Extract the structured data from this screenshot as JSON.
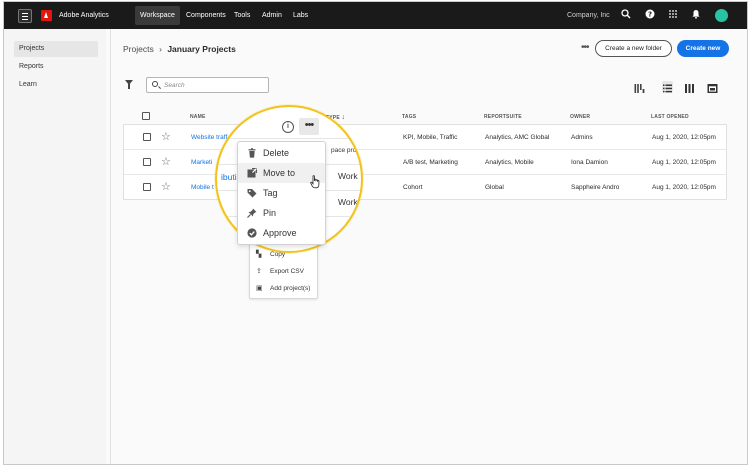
{
  "topbar": {
    "app_name": "Adobe Analytics",
    "nav": [
      "Workspace",
      "Components",
      "Tools",
      "Admin",
      "Labs"
    ],
    "company": "Company, Inc",
    "accent": "#e0170f"
  },
  "sidebar": {
    "items": [
      {
        "label": "Projects"
      },
      {
        "label": "Reports"
      },
      {
        "label": "Learn"
      }
    ]
  },
  "header": {
    "breadcrumb_root": "Projects",
    "breadcrumb_sep": "›",
    "breadcrumb_current": "January Projects",
    "more_label": "•••",
    "new_folder_label": "Create a new folder",
    "create_new_label": "Create new",
    "primary_color": "#1473e6"
  },
  "search": {
    "placeholder": "Search",
    "value": ""
  },
  "table": {
    "headers": {
      "name": "NAME",
      "type": "TYPE",
      "type_sort": "↓",
      "tags": "TAGS",
      "reportsuite": "REPORTSUITE",
      "owner": "OWNER",
      "last_opened": "LAST OPENED"
    },
    "rows": [
      {
        "name": "Website traff",
        "type": "Workspace project",
        "tags": "KPI, Mobile, Traffic",
        "reportsuite": "Analytics, AMC Global",
        "owner": "Admins",
        "last_opened": "Aug 1, 2020, 12:05pm"
      },
      {
        "name": "Marketi",
        "type": "Workspace project",
        "tags": "A/B test, Marketing",
        "reportsuite": "Analytics, Mobile",
        "owner": "Iona Damion",
        "last_opened": "Aug 1, 2020, 12:05pm"
      },
      {
        "name": "Mobile t",
        "type": "Workspace project",
        "tags": "Cohort",
        "reportsuite": "Global",
        "owner": "Sappheire Andro",
        "last_opened": "Aug 1, 2020, 12:05pm"
      }
    ]
  },
  "lens": {
    "row1_type": "pace project",
    "row2_name": "ibuti",
    "row2_type": "Work",
    "row3_type": "Work",
    "info_label": "i",
    "ellipsis_label": "•••",
    "border_color": "#f2c31d"
  },
  "context_menu_primary": [
    {
      "label": "Delete",
      "icon": "trash-icon"
    },
    {
      "label": "Move to",
      "icon": "move-icon"
    },
    {
      "label": "Tag",
      "icon": "tag-icon"
    },
    {
      "label": "Pin",
      "icon": "pin-icon"
    },
    {
      "label": "Approve",
      "icon": "approve-icon"
    }
  ],
  "context_menu_secondary": [
    {
      "label": "Copy",
      "icon": "copy-icon"
    },
    {
      "label": "Export CSV",
      "icon": "export-icon"
    },
    {
      "label": "Add project(s)",
      "icon": "add-project-icon"
    }
  ]
}
